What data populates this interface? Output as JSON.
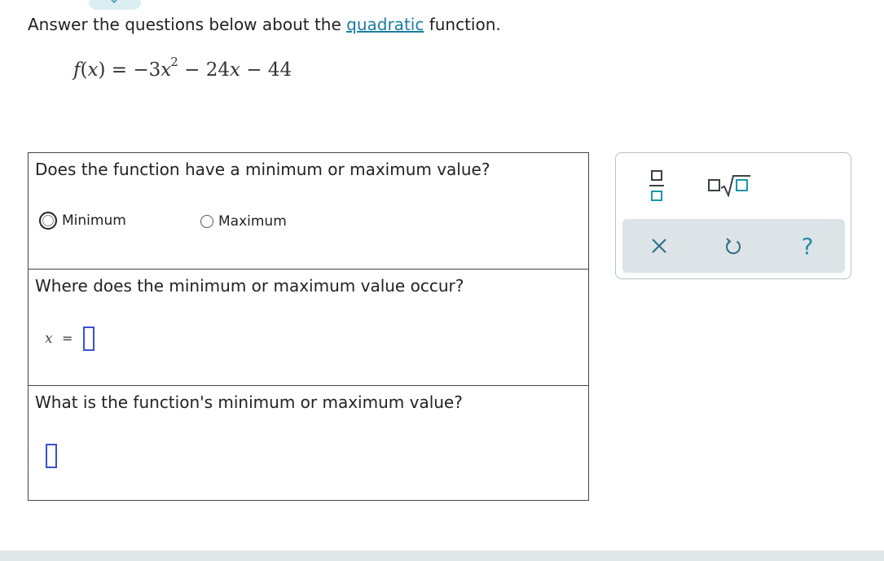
{
  "instructions": {
    "prefix": "Answer the questions below about the ",
    "link": "quadratic",
    "suffix": " function."
  },
  "equation": {
    "f": "f",
    "lparen": "(",
    "x1": "x",
    "rparen": ")",
    "rest1": " = −3",
    "x2": "x",
    "exp": "2",
    "rest2": " − 24",
    "x3": "x",
    "rest3": " − 44"
  },
  "questions": {
    "q1": {
      "text": "Does the function have a minimum or maximum value?",
      "options": [
        {
          "label": "Minimum",
          "selected": false
        },
        {
          "label": "Maximum",
          "selected": false
        }
      ]
    },
    "q2": {
      "text": "Where does the minimum or maximum value occur?",
      "var": "x",
      "eq": "=",
      "answer": ""
    },
    "q3": {
      "text": "What is the function's minimum or maximum value?",
      "answer": ""
    }
  },
  "toolbar": {
    "fraction_icon": "fraction-icon",
    "root_icon": "nth-root-icon",
    "clear_icon": "close-icon",
    "undo_icon": "undo-icon",
    "help_label": "?"
  },
  "colors": {
    "link": "#1a7da0",
    "answer_box": "#3a4fd6",
    "accent": "#1f95a9",
    "action_bar": "#dde4e7"
  }
}
